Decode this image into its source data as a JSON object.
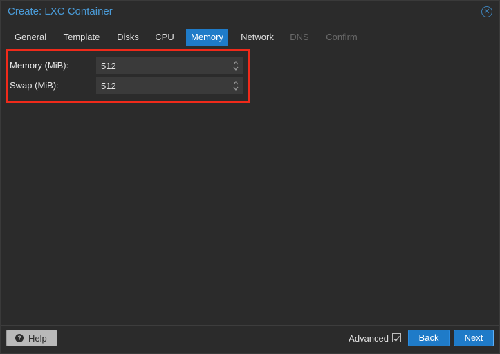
{
  "window": {
    "title": "Create: LXC Container"
  },
  "tabs": [
    {
      "label": "General",
      "state": "normal"
    },
    {
      "label": "Template",
      "state": "normal"
    },
    {
      "label": "Disks",
      "state": "normal"
    },
    {
      "label": "CPU",
      "state": "normal"
    },
    {
      "label": "Memory",
      "state": "active"
    },
    {
      "label": "Network",
      "state": "normal"
    },
    {
      "label": "DNS",
      "state": "disabled"
    },
    {
      "label": "Confirm",
      "state": "disabled"
    }
  ],
  "form": {
    "memory": {
      "label": "Memory (MiB):",
      "value": "512"
    },
    "swap": {
      "label": "Swap (MiB):",
      "value": "512"
    }
  },
  "footer": {
    "help_label": "Help",
    "advanced_label": "Advanced",
    "advanced_checked": true,
    "back_label": "Back",
    "next_label": "Next"
  },
  "colors": {
    "accent": "#1f7bc8",
    "title": "#4a9ad6",
    "highlight": "#f02a1a",
    "background": "#2b2b2b"
  }
}
